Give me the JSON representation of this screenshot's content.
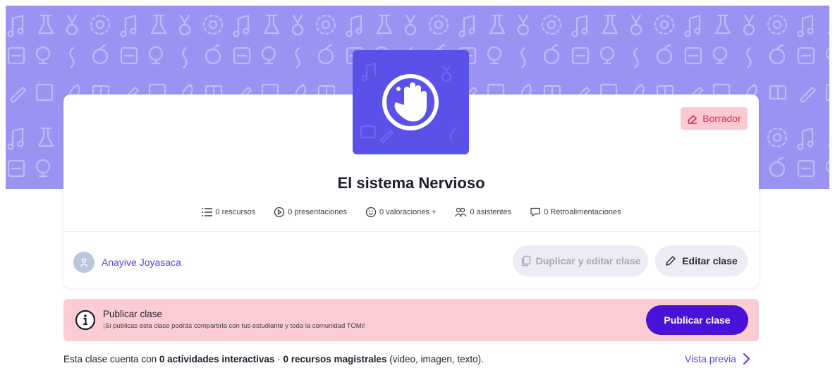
{
  "class": {
    "title": "El sistema Nervioso",
    "status": "Borrador",
    "status_icon": "eraser-icon",
    "logo_icon": "waving-hand-icon"
  },
  "stats": [
    {
      "icon": "list-icon",
      "label": "0 rescursos"
    },
    {
      "icon": "play-circle-icon",
      "label": "0 presentaciones"
    },
    {
      "icon": "smile-icon",
      "label": "0 valoraciones +"
    },
    {
      "icon": "people-icon",
      "label": "0 asistentes"
    },
    {
      "icon": "comment-icon",
      "label": "0 Retroalimentaciones"
    }
  ],
  "author": {
    "name": "Anayive Joyasaca",
    "avatar_icon": "user-icon"
  },
  "actions": {
    "duplicate_label": "Duplicar y editar clase",
    "edit_label": "Editar clase"
  },
  "publish": {
    "title": "Publicar clase",
    "description": "¡Si publicas esta clase podrás compartirla con tus estudiante y toda la comunidad TOMi!",
    "button_label": "Publicar clase"
  },
  "footer": {
    "prefix": "Esta clase cuenta con ",
    "activities": "0 actividades interactivas",
    "separator": " · ",
    "resources": "0 recursos magistrales",
    "suffix": " (video, imagen, texto).",
    "preview_label": "Vista previa"
  },
  "colors": {
    "hero": "#9b93f2",
    "logo_bg": "#5a52e8",
    "accent": "#5b3df0",
    "publish_button": "#4a12d6",
    "badge_bg": "#fcc9d2",
    "badge_text": "#d92d4b",
    "publish_bar_bg": "#fcccd5"
  }
}
